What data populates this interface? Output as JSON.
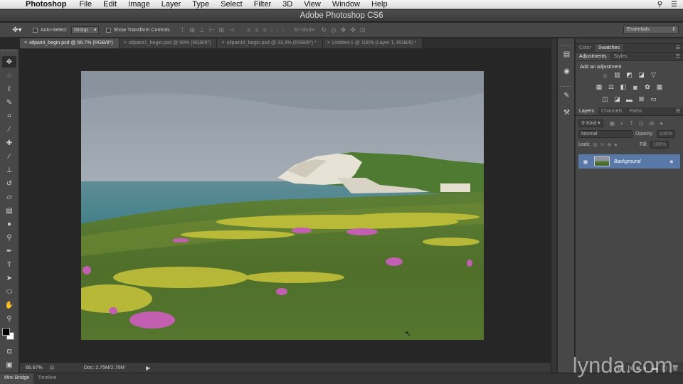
{
  "menubar": {
    "app_name": "Photoshop",
    "items": [
      "File",
      "Edit",
      "Image",
      "Layer",
      "Type",
      "Select",
      "Filter",
      "3D",
      "View",
      "Window",
      "Help"
    ]
  },
  "window": {
    "title": "Adobe Photoshop CS6"
  },
  "options": {
    "auto_select_label": "Auto-Select:",
    "auto_select_value": "Group",
    "transform_label": "Show Transform Controls",
    "mode_3d_label": "3D Mode:",
    "workspace": "Essentials"
  },
  "tabs": [
    {
      "label": "oilpaint_begin.psd @ 66.7% (RGB/8*)"
    },
    {
      "label": "oilpaint1_begin.psd @ 50% (RGB/8*)"
    },
    {
      "label": "oilpaint3_begin.psd @ 33.3% (RGB/8*) *"
    },
    {
      "label": "Untitled-1 @ 100% (Layer 1, RGB/8) *"
    }
  ],
  "status": {
    "zoom": "66.67%",
    "doc_size": "Doc: 2.75M/2.75M"
  },
  "bottom_tabs": [
    "Mini Bridge",
    "Timeline"
  ],
  "panels": {
    "color_tabs": [
      "Color",
      "Swatches"
    ],
    "adj_tabs": [
      "Adjustments",
      "Styles"
    ],
    "adj_title": "Add an adjustment",
    "layers_tabs": [
      "Layers",
      "Channels",
      "Paths"
    ],
    "kind_label": "Kind",
    "blend_mode": "Normal",
    "opacity_label": "Opacity:",
    "opacity_value": "100%",
    "lock_label": "Lock:",
    "fill_label": "Fill:",
    "fill_value": "100%",
    "layer_name": "Background"
  },
  "watermark": "lynda.com"
}
